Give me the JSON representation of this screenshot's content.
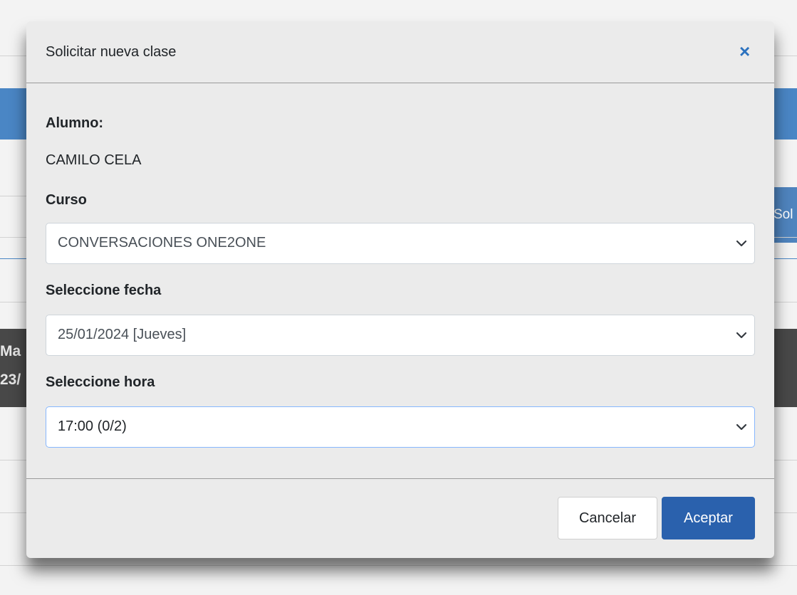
{
  "background": {
    "side_button_label": "Sol",
    "dark_row_lines": [
      "Ma",
      "23/"
    ]
  },
  "modal": {
    "title": "Solicitar nueva clase",
    "close_glyph": "×",
    "student": {
      "label": "Alumno:",
      "value": "CAMILO CELA"
    },
    "course": {
      "label": "Curso",
      "selected": "CONVERSACIONES ONE2ONE"
    },
    "date": {
      "label": "Seleccione fecha",
      "selected": "25/01/2024 [Jueves]"
    },
    "time": {
      "label": "Seleccione hora",
      "selected": "17:00 (0/2)"
    },
    "footer": {
      "cancel_label": "Cancelar",
      "accept_label": "Aceptar"
    }
  },
  "colors": {
    "accent": "#2a61ad",
    "close_icon": "#2c72bf",
    "background_bar": "#4a86c5",
    "background_dark_row": "#484848"
  },
  "icons": {
    "close": "close-icon",
    "select_arrow": "chevron-down-icon"
  }
}
